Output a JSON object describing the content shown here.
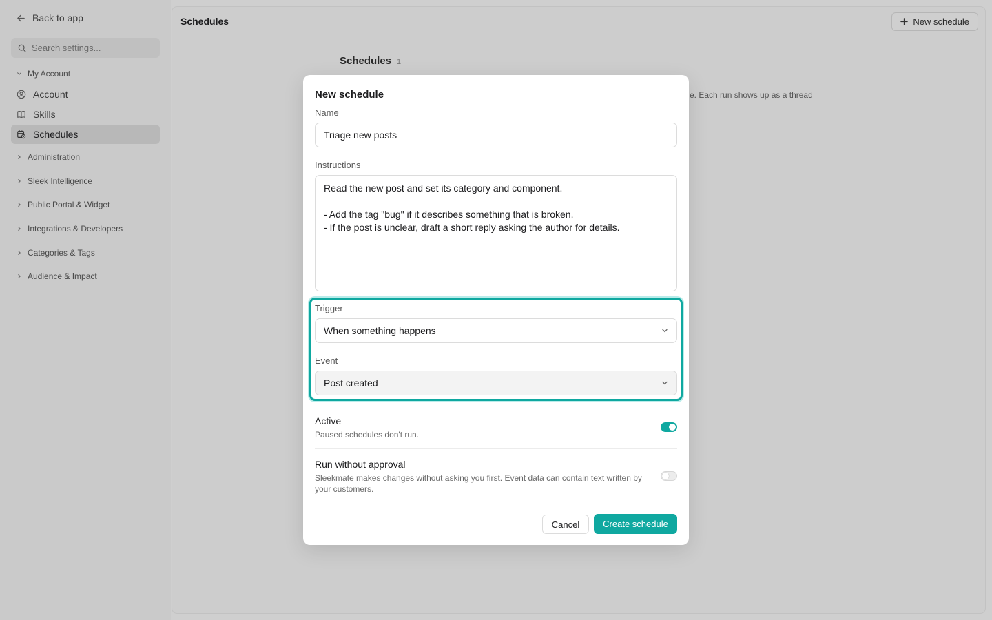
{
  "sidebar": {
    "back_label": "Back to app",
    "search_placeholder": "Search settings...",
    "my_account": {
      "label": "My Account",
      "items": [
        {
          "label": "Account",
          "icon": "user-circle-icon"
        },
        {
          "label": "Skills",
          "icon": "book-icon"
        },
        {
          "label": "Schedules",
          "icon": "calendar-clock-icon",
          "active": true
        }
      ]
    },
    "groups": [
      {
        "label": "Administration"
      },
      {
        "label": "Sleek Intelligence"
      },
      {
        "label": "Public Portal & Widget"
      },
      {
        "label": "Integrations & Developers"
      },
      {
        "label": "Categories & Tags"
      },
      {
        "label": "Audience & Impact"
      }
    ]
  },
  "main": {
    "title": "Schedules",
    "new_schedule_label": "New schedule",
    "section_title": "Schedules",
    "section_count": "1",
    "section_desc_partial": "e. Each run shows up as a thread"
  },
  "modal": {
    "title": "New schedule",
    "name_label": "Name",
    "name_value": "Triage new posts",
    "instructions_label": "Instructions",
    "instructions_value": "Read the new post and set its category and component.\n\n- Add the tag \"bug\" if it describes something that is broken.\n- If the post is unclear, draft a short reply asking the author for details.",
    "trigger_label": "Trigger",
    "trigger_value": "When something happens",
    "event_label": "Event",
    "event_value": "Post created",
    "active_title": "Active",
    "active_desc": "Paused schedules don't run.",
    "active_on": true,
    "approval_title": "Run without approval",
    "approval_desc": "Sleekmate makes changes without asking you first. Event data can contain text written by your customers.",
    "approval_on": false,
    "cancel_label": "Cancel",
    "create_label": "Create schedule"
  },
  "colors": {
    "accent": "#0fa8a0",
    "overlay_bg": "#cfcfcf",
    "modal_bg": "#ffffff"
  }
}
